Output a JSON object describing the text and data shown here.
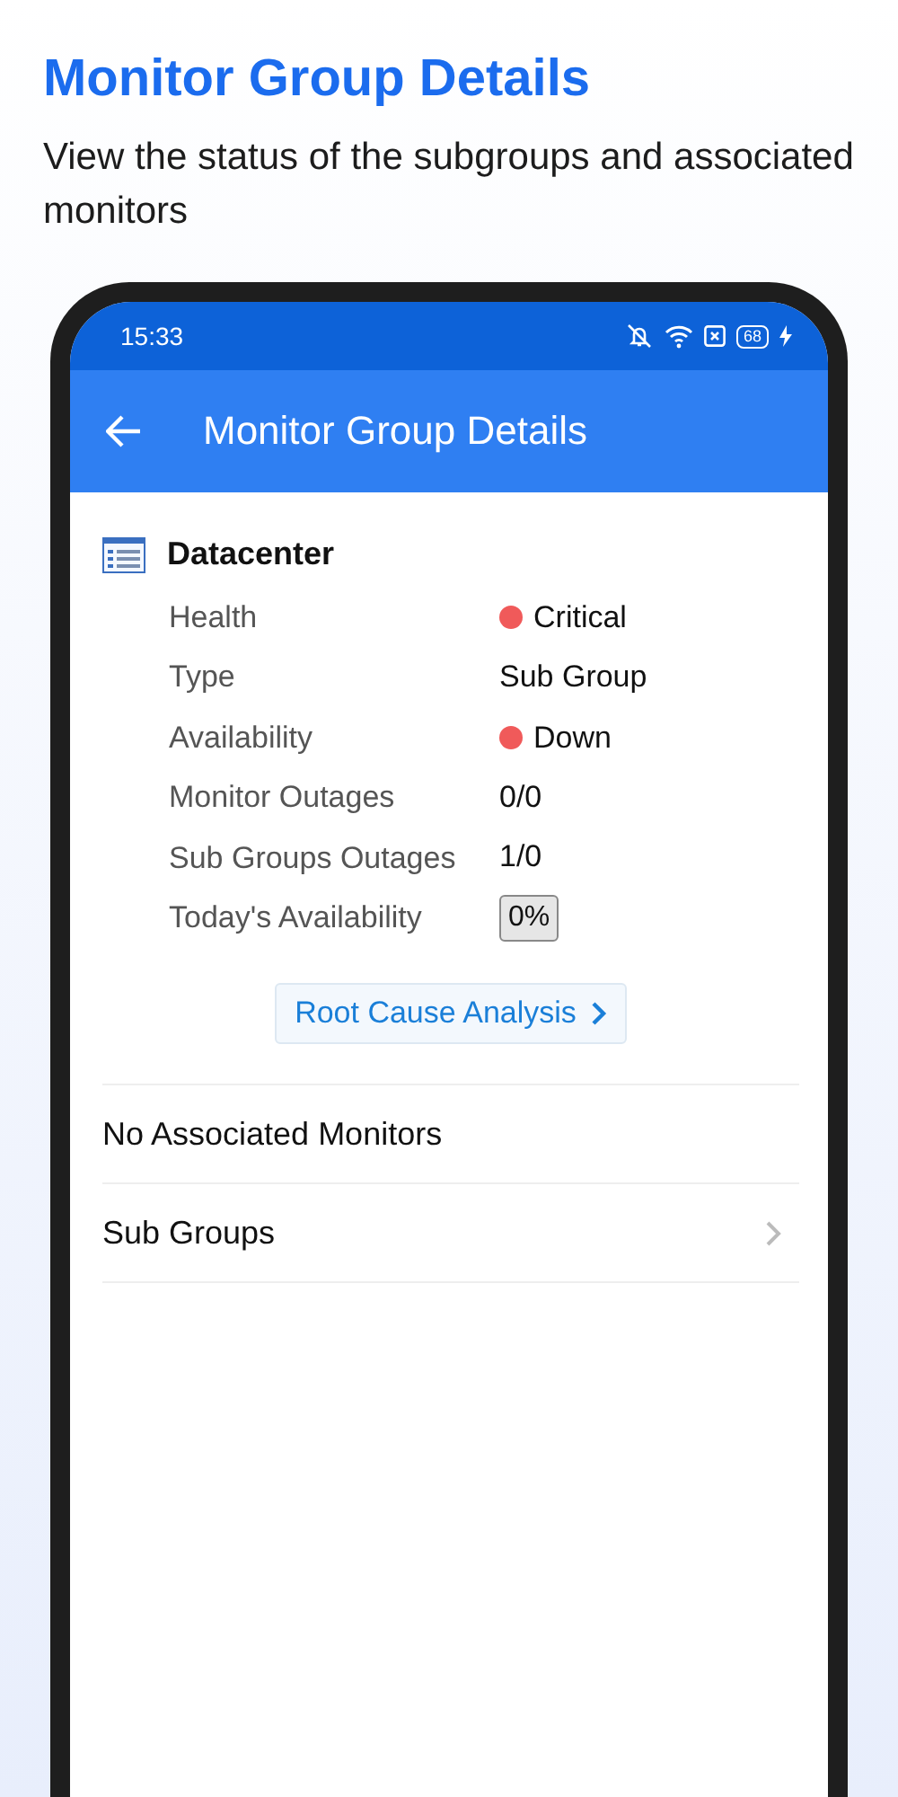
{
  "header": {
    "title": "Monitor Group Details",
    "subtitle": "View the status of the subgroups and associated monitors"
  },
  "status_bar": {
    "time": "15:33",
    "battery": "68"
  },
  "app_bar": {
    "title": "Monitor Group Details"
  },
  "group": {
    "name": "Datacenter",
    "details": [
      {
        "label": "Health",
        "value": "Critical",
        "kind": "status",
        "color": "#f05a5a"
      },
      {
        "label": "Type",
        "value": "Sub Group",
        "kind": "text"
      },
      {
        "label": "Availability",
        "value": "Down",
        "kind": "status",
        "color": "#f05a5a"
      },
      {
        "label": "Monitor Outages",
        "value": "0/0",
        "kind": "text"
      },
      {
        "label": "Sub Groups Outages",
        "value": "1/0",
        "kind": "text"
      },
      {
        "label": "Today's Availability",
        "value": "0%",
        "kind": "badge"
      }
    ],
    "action": "Root Cause Analysis"
  },
  "sections": [
    {
      "label": "No Associated Monitors",
      "kind": "text"
    },
    {
      "label": "Sub Groups",
      "kind": "link"
    }
  ]
}
